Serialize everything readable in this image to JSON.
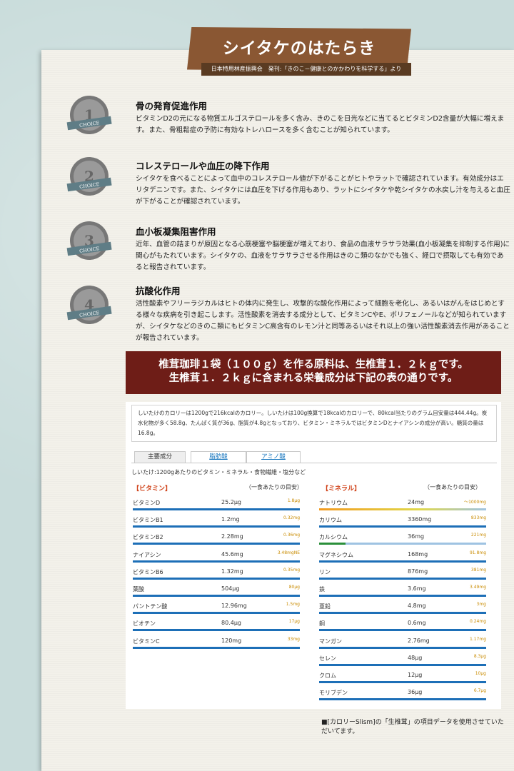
{
  "title": "シイタケのはたらき",
  "subtitle": "日本特用林産振興会　発刊:「きのこ－健康とのかかわりを科学する」より",
  "badge_text": "CHOICE",
  "sections": [
    {
      "num": "1",
      "heading": "骨の発育促進作用",
      "body": "ビタミンD2の元になる物質エルゴステロールを多く含み、きのこを日光などに当てるとビタミンD2含量が大幅に増えます。また、骨粗鬆症の予防に有効なトレハロースを多く含むことが知られています。"
    },
    {
      "num": "2",
      "heading": "コレステロールや血圧の降下作用",
      "body": "シイタケを食べることによって血中のコレステロール値が下がることがヒトやラットで確認されています。有効成分はエリタデニンです。また、シイタケには血圧を下げる作用もあり、ラットにシイタケや乾シイタケの水戻し汁を与えると血圧が下がることが確認されています。"
    },
    {
      "num": "3",
      "heading": "血小板凝集阻害作用",
      "body": "近年、血管の詰まりが原因となる心筋梗塞や脳梗塞が増えており、食品の血液サラサラ効果(血小板凝集を抑制する作用)に関心がもたれています。シイタケの、血液をサラサラさせる作用はきのこ類のなかでも強く、経口で摂取しても有効であると報告されています。"
    },
    {
      "num": "4",
      "heading": "抗酸化作用",
      "body": "活性酸素やフリーラジカルはヒトの体内に発生し、攻撃的な酸化作用によって細胞を老化し、あるいはがんをはじめとする様々な疾病を引き起こします。活性酸素を消去する成分として、ビタミンCやE、ポリフェノールなどが知られていますが、シイタケなどのきのこ類にもビタミンC高含有のレモン汁と同等あるいはそれ以上の強い活性酸素消去作用があることが報告されています。"
    }
  ],
  "highlight": {
    "line1": "椎茸珈琲１袋（１００ｇ）を作る原料は、生椎茸１．２ｋｇです。",
    "line2": "生椎茸１．２ｋｇに含まれる栄養成分は下記の表の通りです。"
  },
  "intro_text": "しいたけのカロリーは1200gで216kcalのカロリー。しいたけは100g換算で18kcalのカロリーで、80kcal当たりのグラム目安量は444.44g。炭水化物が多く58.8g、たんぱく質が36g、脂質が4.8gとなっており、ビタミン・ミネラルではビタミンDとナイアシンの成分が高い。糖質の量は16.8g。",
  "tabs": [
    {
      "label": "主要成分",
      "active": true
    },
    {
      "label": "脂肪酸",
      "active": false
    },
    {
      "label": "アミノ酸",
      "active": false
    }
  ],
  "panel_caption": "しいたけ:1200gあたりのビタミン・ミネラル・食物繊維・塩分など",
  "vitamins": {
    "heading": "【ビタミン】",
    "guide_label": "（一食あたりの目安）",
    "rows": [
      {
        "name": "ビタミンD",
        "value": "25.2μg",
        "guide": "1.8μg"
      },
      {
        "name": "ビタミンB1",
        "value": "1.2mg",
        "guide": "0.32mg"
      },
      {
        "name": "ビタミンB2",
        "value": "2.28mg",
        "guide": "0.36mg"
      },
      {
        "name": "ナイアシン",
        "value": "45.6mg",
        "guide": "3.48mgNE"
      },
      {
        "name": "ビタミンB6",
        "value": "1.32mg",
        "guide": "0.35mg"
      },
      {
        "name": "葉酸",
        "value": "504μg",
        "guide": "80μg"
      },
      {
        "name": "パントテン酸",
        "value": "12.96mg",
        "guide": "1.5mg"
      },
      {
        "name": "ビオチン",
        "value": "80.4μg",
        "guide": "17μg"
      },
      {
        "name": "ビタミンC",
        "value": "120mg",
        "guide": "33mg"
      }
    ]
  },
  "minerals": {
    "heading": "【ミネラル】",
    "guide_label": "（一食あたりの目安）",
    "rows": [
      {
        "name": "ナトリウム",
        "value": "24mg",
        "guide": "～1000mg",
        "fill": 0.02,
        "fill_color": "#f29a1f",
        "style": "sodium"
      },
      {
        "name": "カリウム",
        "value": "3360mg",
        "guide": "833mg"
      },
      {
        "name": "カルシウム",
        "value": "36mg",
        "guide": "221mg",
        "fill": 0.16,
        "fill_color": "#2b8f3a"
      },
      {
        "name": "マグネシウム",
        "value": "168mg",
        "guide": "91.8mg"
      },
      {
        "name": "リン",
        "value": "876mg",
        "guide": "381mg"
      },
      {
        "name": "鉄",
        "value": "3.6mg",
        "guide": "3.49mg"
      },
      {
        "name": "亜鉛",
        "value": "4.8mg",
        "guide": "3mg"
      },
      {
        "name": "銅",
        "value": "0.6mg",
        "guide": "0.24mg"
      },
      {
        "name": "マンガン",
        "value": "2.76mg",
        "guide": "1.17mg"
      },
      {
        "name": "セレン",
        "value": "48μg",
        "guide": "8.3μg"
      },
      {
        "name": "クロム",
        "value": "12μg",
        "guide": "10μg"
      },
      {
        "name": "モリブデン",
        "value": "36μg",
        "guide": "6.7μg"
      }
    ]
  },
  "footnote": "■[カロリーSlism]の「生椎茸」の項目データを使用させていただいてます。"
}
